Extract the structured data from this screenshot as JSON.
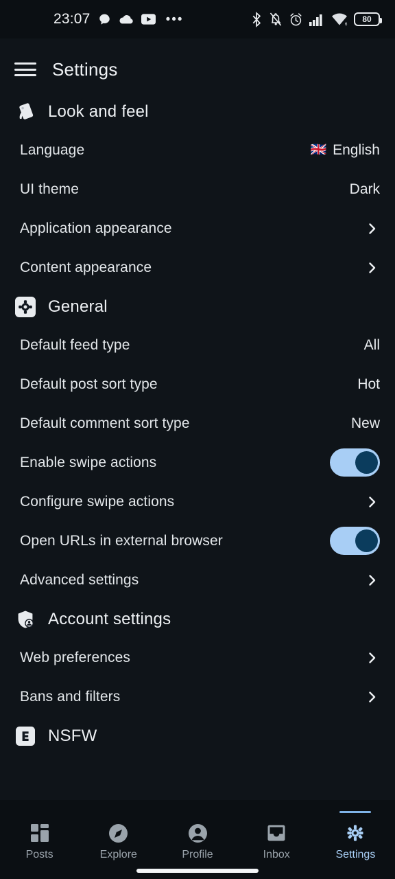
{
  "statusbar": {
    "time": "23:07",
    "notification_icons": [
      "chat-bubble-icon",
      "cloud-icon",
      "youtube-icon"
    ],
    "overflow": "•••",
    "right_icons": [
      "bluetooth-icon",
      "notifications-muted-icon",
      "alarm-icon",
      "signal-bars-icon",
      "wifi-icon"
    ],
    "battery_level": "80"
  },
  "appbar": {
    "menu_icon": "hamburger-menu-icon",
    "title": "Settings"
  },
  "colors": {
    "background": "#0f1419",
    "bar_background": "#0b0f13",
    "accent": "#a8cef5",
    "toggle_knob": "#0b3c5d",
    "text": "#e3e7ea",
    "muted_text": "#9aa3ab"
  },
  "sections": [
    {
      "id": "look-and-feel",
      "icon": "palette-icon",
      "title": "Look and feel",
      "rows": [
        {
          "id": "language",
          "label": "Language",
          "type": "value",
          "value": "English",
          "flag": "🇬🇧"
        },
        {
          "id": "ui-theme",
          "label": "UI theme",
          "type": "value",
          "value": "Dark"
        },
        {
          "id": "application-appearance",
          "label": "Application appearance",
          "type": "chevron"
        },
        {
          "id": "content-appearance",
          "label": "Content appearance",
          "type": "chevron"
        }
      ]
    },
    {
      "id": "general",
      "icon": "gear-badge-icon",
      "title": "General",
      "rows": [
        {
          "id": "default-feed-type",
          "label": "Default feed type",
          "type": "value",
          "value": "All"
        },
        {
          "id": "default-post-sort-type",
          "label": "Default post sort type",
          "type": "value",
          "value": "Hot"
        },
        {
          "id": "default-comment-sort-type",
          "label": "Default comment sort type",
          "type": "value",
          "value": "New"
        },
        {
          "id": "enable-swipe-actions",
          "label": "Enable swipe actions",
          "type": "toggle",
          "value": "on"
        },
        {
          "id": "configure-swipe-actions",
          "label": "Configure swipe actions",
          "type": "chevron"
        },
        {
          "id": "open-urls-external",
          "label": "Open URLs in external browser",
          "type": "toggle",
          "value": "on"
        },
        {
          "id": "advanced-settings",
          "label": "Advanced settings",
          "type": "chevron"
        }
      ]
    },
    {
      "id": "account-settings",
      "icon": "shield-user-icon",
      "title": "Account settings",
      "rows": [
        {
          "id": "web-preferences",
          "label": "Web preferences",
          "type": "chevron"
        },
        {
          "id": "bans-and-filters",
          "label": "Bans and filters",
          "type": "chevron"
        }
      ]
    },
    {
      "id": "nsfw",
      "icon": "explicit-badge-icon",
      "title": "NSFW",
      "rows": []
    }
  ],
  "bottomnav": {
    "items": [
      {
        "id": "posts",
        "label": "Posts",
        "icon": "grid-icon",
        "active": false
      },
      {
        "id": "explore",
        "label": "Explore",
        "icon": "compass-icon",
        "active": false
      },
      {
        "id": "profile",
        "label": "Profile",
        "icon": "person-circle-icon",
        "active": false
      },
      {
        "id": "inbox",
        "label": "Inbox",
        "icon": "inbox-tray-icon",
        "active": false
      },
      {
        "id": "settings",
        "label": "Settings",
        "icon": "gear-icon",
        "active": true
      }
    ]
  }
}
